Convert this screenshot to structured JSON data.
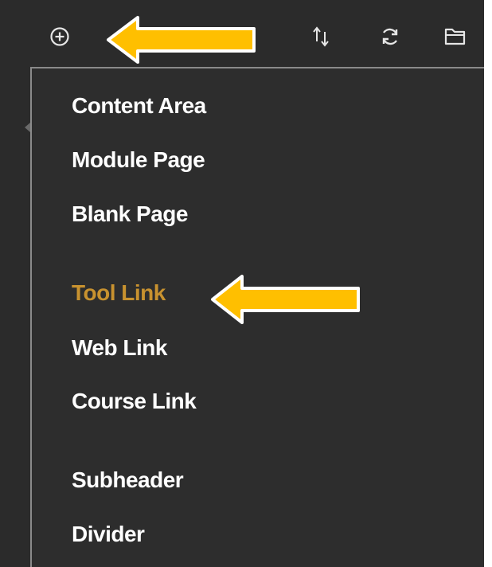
{
  "toolbar": {
    "buttons": [
      {
        "icon": "plus-circle-icon"
      },
      {
        "icon": "reorder-icon"
      },
      {
        "icon": "refresh-icon"
      },
      {
        "icon": "folder-icon"
      }
    ]
  },
  "menu": {
    "items": [
      {
        "label": "Content Area"
      },
      {
        "label": "Module Page"
      },
      {
        "label": "Blank Page"
      },
      {
        "label": "Tool Link",
        "highlighted": true
      },
      {
        "label": "Web Link"
      },
      {
        "label": "Course Link"
      },
      {
        "label": "Subheader"
      },
      {
        "label": "Divider"
      }
    ]
  },
  "colors": {
    "background": "#2b2b2b",
    "text": "#ffffff",
    "highlight": "#c8922f",
    "arrow": "#ffbf00"
  }
}
